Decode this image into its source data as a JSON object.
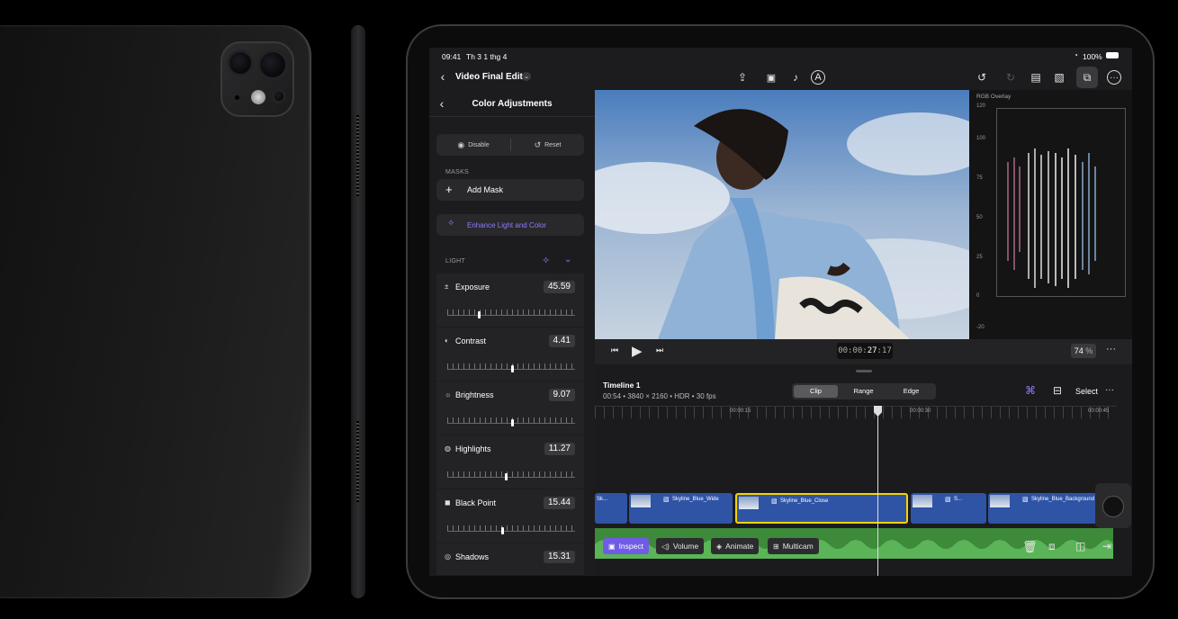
{
  "status": {
    "time": "09:41",
    "date": "Th 3 1 thg 4",
    "battery": "100%"
  },
  "topbar": {
    "project_title": "Video Final Edit"
  },
  "panel": {
    "title": "Color Adjustments",
    "disable_label": "Disable",
    "reset_label": "Reset",
    "masks_header": "MASKS",
    "add_mask_label": "Add Mask",
    "enhance_label": "Enhance Light and Color",
    "light_header": "LIGHT",
    "sliders": [
      {
        "label": "Exposure",
        "value": "45.59",
        "icon": "plus-minus-icon"
      },
      {
        "label": "Contrast",
        "value": "4.41",
        "icon": "contrast-icon"
      },
      {
        "label": "Brightness",
        "value": "9.07",
        "icon": "sun-icon"
      },
      {
        "label": "Highlights",
        "value": "11.27",
        "icon": "highlights-icon"
      },
      {
        "label": "Black Point",
        "value": "15.44",
        "icon": "black-point-icon"
      },
      {
        "label": "Shadows",
        "value": "15.31",
        "icon": "shadows-icon"
      }
    ]
  },
  "scope": {
    "title": "RGB Overlay",
    "axis": [
      "120",
      "100",
      "75",
      "50",
      "25",
      "0",
      "-20"
    ]
  },
  "transport": {
    "timecode_prefix": "00:00:",
    "timecode_main": "27",
    "timecode_frames": ":17",
    "zoom": "74",
    "zoom_unit": "%"
  },
  "timeline": {
    "name": "Timeline 1",
    "info": "00:54 • 3840 × 2160 • HDR • 30 fps",
    "modes": [
      "Clip",
      "Range",
      "Edge"
    ],
    "select_label": "Select",
    "ruler": [
      "00:00:15",
      "00:00:30",
      "00:00:45"
    ],
    "clips": [
      "Sk...",
      "Skyline_Blue_Wide",
      "Skyline_Blue_Close",
      "S...",
      "Skyline_Blue_Background"
    ],
    "bottom_buttons": [
      "Inspect",
      "Volume",
      "Animate",
      "Multicam"
    ]
  },
  "colors": {
    "accent": "#8a7dff",
    "clip_blue": "#2f54a6",
    "audio_green": "#3c8a3a",
    "selection_yellow": "#f5d300"
  }
}
